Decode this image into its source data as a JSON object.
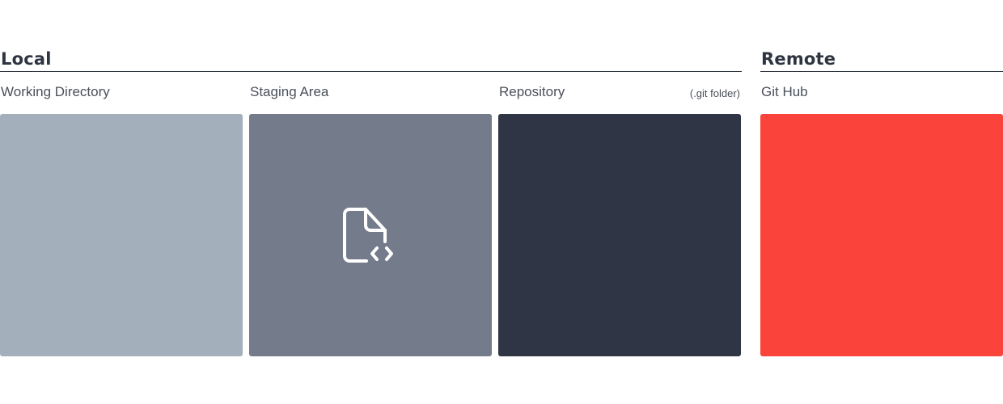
{
  "local": {
    "title": "Local",
    "columns": [
      {
        "label": "Working Directory",
        "note": "",
        "color": "#a4afbc",
        "icon": ""
      },
      {
        "label": "Staging Area",
        "note": "",
        "color": "#747c8b",
        "icon": "file-code-icon"
      },
      {
        "label": "Repository",
        "note": "(.git folder)",
        "color": "#2f3544",
        "icon": ""
      }
    ]
  },
  "remote": {
    "title": "Remote",
    "columns": [
      {
        "label": "Git Hub",
        "note": "",
        "color": "#fa433a",
        "icon": ""
      }
    ]
  }
}
